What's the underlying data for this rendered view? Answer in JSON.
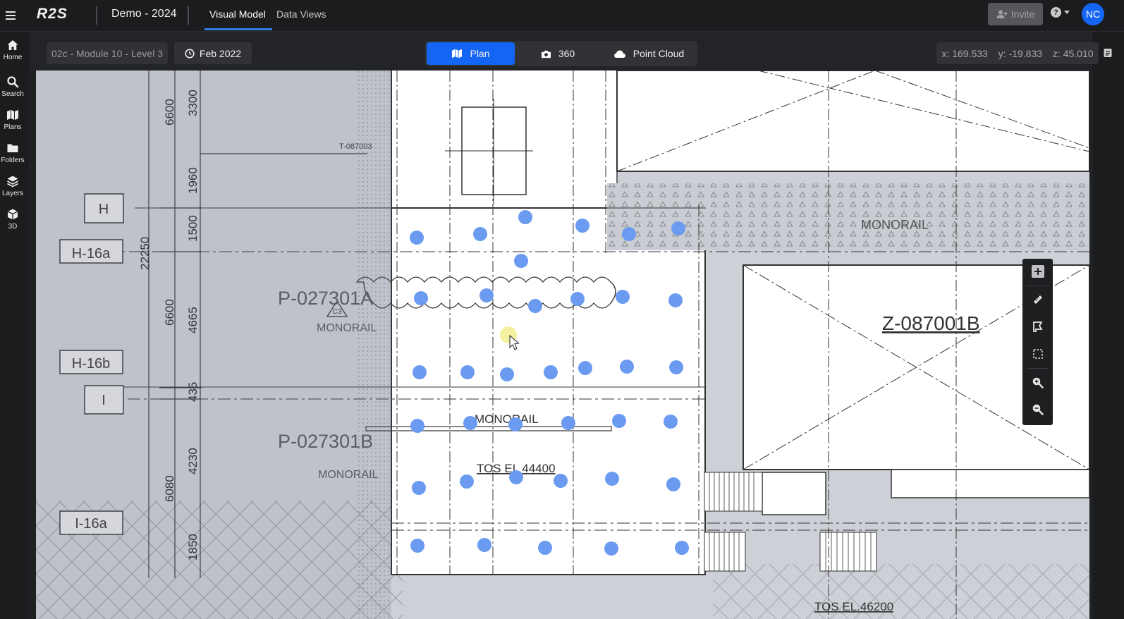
{
  "header": {
    "logo": "R2S",
    "project": "Demo - 2024",
    "tabs": [
      {
        "label": "Visual Model",
        "active": true
      },
      {
        "label": "Data Views",
        "active": false
      }
    ],
    "invite_label": "Invite",
    "avatar_initials": "NC",
    "accent_color": "#1565f4"
  },
  "sidebar": {
    "items": [
      {
        "label": "Home",
        "icon": "home-icon"
      },
      {
        "label": "Search",
        "icon": "search-icon"
      },
      {
        "label": "Plans",
        "icon": "map-icon"
      },
      {
        "label": "Folders",
        "icon": "folder-icon"
      },
      {
        "label": "Layers",
        "icon": "layers-icon"
      },
      {
        "label": "3D",
        "icon": "cube-icon"
      }
    ]
  },
  "subbar": {
    "location": "02c - Module 10 - Level 3",
    "date": "Feb 2022",
    "view_modes": [
      {
        "label": "Plan",
        "icon": "map-icon",
        "active": true
      },
      {
        "label": "360",
        "icon": "camera-icon",
        "active": false
      },
      {
        "label": "Point Cloud",
        "icon": "cloud-icon",
        "active": false
      }
    ],
    "coords": {
      "x": "x: 169.533",
      "y": "y: -19.833",
      "z": "z: 45.010"
    }
  },
  "plan": {
    "labels": {
      "h": "H",
      "h16a": "H-16a",
      "h16b": "H-16b",
      "i": "I",
      "i16a": "I-16a",
      "p027301a": "P-027301A",
      "p027301b": "P-027301B",
      "monorail_1": "MONORAIL",
      "monorail_2": "MONORAIL",
      "monorail_3": "MONORAIL",
      "monorail_4": "MONORAIL",
      "tos_44400": "TOS EL 44400",
      "tos_46200": "TOS EL.46200",
      "z087001b": "Z-087001B",
      "t087003": "T-087003",
      "c3": "C3",
      "dim_6600a": "6600",
      "dim_3300": "3300",
      "dim_1960": "1960",
      "dim_1500": "1500",
      "dim_22250": "22250",
      "dim_6600b": "6600",
      "dim_4665": "4665",
      "dim_435": "435",
      "dim_4230": "4230",
      "dim_6080": "6080",
      "dim_1850": "1850"
    },
    "capture_points_color": "#6b9bf0",
    "capture_point_count": 40
  },
  "toolbar": {
    "tools": [
      "plus-icon",
      "measure-icon",
      "annotate-icon",
      "select-area-icon",
      "zoom-in-icon",
      "zoom-out-icon"
    ]
  },
  "right_rail": {
    "icon": "notes-icon"
  }
}
